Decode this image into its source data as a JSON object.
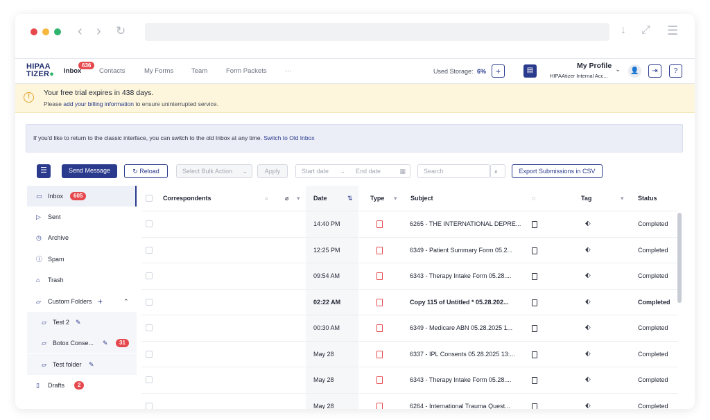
{
  "browser": {
    "dots": [
      "#e5484d",
      "#f5b83d",
      "#2fb36f"
    ]
  },
  "app": {
    "logo_top": "HIPAA",
    "logo_bottom": "TIZER",
    "nav": {
      "inbox": "Inbox",
      "inbox_badge": "636",
      "contacts": "Contacts",
      "my_forms": "My Forms",
      "team": "Team",
      "form_packets": "Form Packets",
      "more": "···"
    },
    "storage_label": "Used Storage:",
    "storage_value": "6%",
    "profile_name": "My Profile",
    "profile_account": "HIPAAtizer Internal Acc..."
  },
  "trial": {
    "title": "Your free trial expires in 438 days.",
    "sub_pre": "Please ",
    "sub_link": "add your billing information",
    "sub_post": " to ensure uninterrupted service."
  },
  "classic": {
    "text": "If you'd like to return to the classic interface, you can switch to the old Inbox at any time.",
    "link": "Switch to Old Inbox"
  },
  "toolbar": {
    "send_message": "Send Message",
    "reload": "Reload",
    "bulk_action_placeholder": "Select Bulk Action",
    "apply": "Apply",
    "start_date": "Start date",
    "end_date": "End date",
    "search_placeholder": "Search",
    "export": "Export Submissions in CSV"
  },
  "sidebar": {
    "items": [
      {
        "label": "Inbox",
        "badge": "605",
        "icon": "inbox-icon"
      },
      {
        "label": "Sent",
        "icon": "send-icon"
      },
      {
        "label": "Archive",
        "icon": "archive-icon"
      },
      {
        "label": "Spam",
        "icon": "spam-icon"
      },
      {
        "label": "Trash",
        "icon": "trash-icon"
      },
      {
        "label": "Custom Folders",
        "icon": "folder-icon"
      },
      {
        "label": "Test 2",
        "icon": "folder-icon"
      },
      {
        "label": "Botox Conse...",
        "badge": "31",
        "icon": "folder-icon"
      },
      {
        "label": "Test folder",
        "icon": "folder-icon"
      },
      {
        "label": "Drafts",
        "badge": "2",
        "icon": "drafts-icon"
      }
    ]
  },
  "table": {
    "headers": {
      "correspondents": "Correspondents",
      "date": "Date",
      "type": "Type",
      "subject": "Subject",
      "tag": "Tag",
      "status": "Status"
    },
    "rows": [
      {
        "date": "14:40 PM",
        "subject": "6265 - THE INTERNATIONAL DEPRE...",
        "status": "Completed"
      },
      {
        "date": "12:25 PM",
        "subject": "6349 - Patient Summary Form 05.2...",
        "status": "Completed"
      },
      {
        "date": "09:54 AM",
        "subject": "6343 - Therapy Intake Form 05.28....",
        "status": "Completed"
      },
      {
        "date": "02:22 AM",
        "subject": "Copy 115 of Untitled * 05.28.202...",
        "status": "Completed"
      },
      {
        "date": "00:30 AM",
        "subject": "6349 - Medicare ABN 05.28.2025 1...",
        "status": "Completed"
      },
      {
        "date": "May 28",
        "subject": "6337 - IPL Consents 05.28.2025 13:...",
        "status": "Completed"
      },
      {
        "date": "May 28",
        "subject": "6343 - Therapy Intake Form 05.28....",
        "status": "Completed"
      },
      {
        "date": "May 28",
        "subject": "6264 - International Trauma Quest...",
        "status": "Completed"
      }
    ]
  },
  "colors": {
    "brand": "#2a3a8c",
    "badge": "#e5484d",
    "trial_bg": "#fdf6dd"
  }
}
